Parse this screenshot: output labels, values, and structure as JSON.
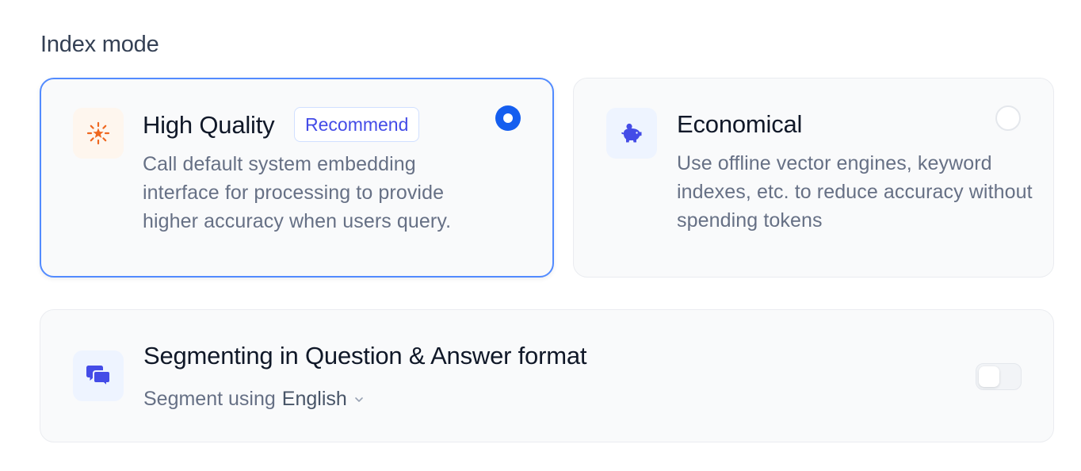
{
  "section": {
    "title": "Index mode"
  },
  "options": {
    "high_quality": {
      "title": "High Quality",
      "badge": "Recommend",
      "description": "Call default system embedding interface for processing to provide higher accuracy when users query.",
      "icon": "sun-sparkle-icon",
      "selected": true
    },
    "economical": {
      "title": "Economical",
      "description": "Use offline vector engines, keyword indexes, etc. to reduce accuracy without spending tokens",
      "icon": "piggy-bank-icon",
      "selected": false
    }
  },
  "qa_segment": {
    "title": "Segmenting in Question & Answer format",
    "segment_prefix": "Segment using",
    "language": "English",
    "icon": "chat-bubbles-icon",
    "enabled": false
  },
  "colors": {
    "accent": "#155eef",
    "selected_border": "#528bff",
    "badge_text": "#444ce7",
    "orange_icon": "#ef6820",
    "indigo_icon": "#444ce7"
  }
}
